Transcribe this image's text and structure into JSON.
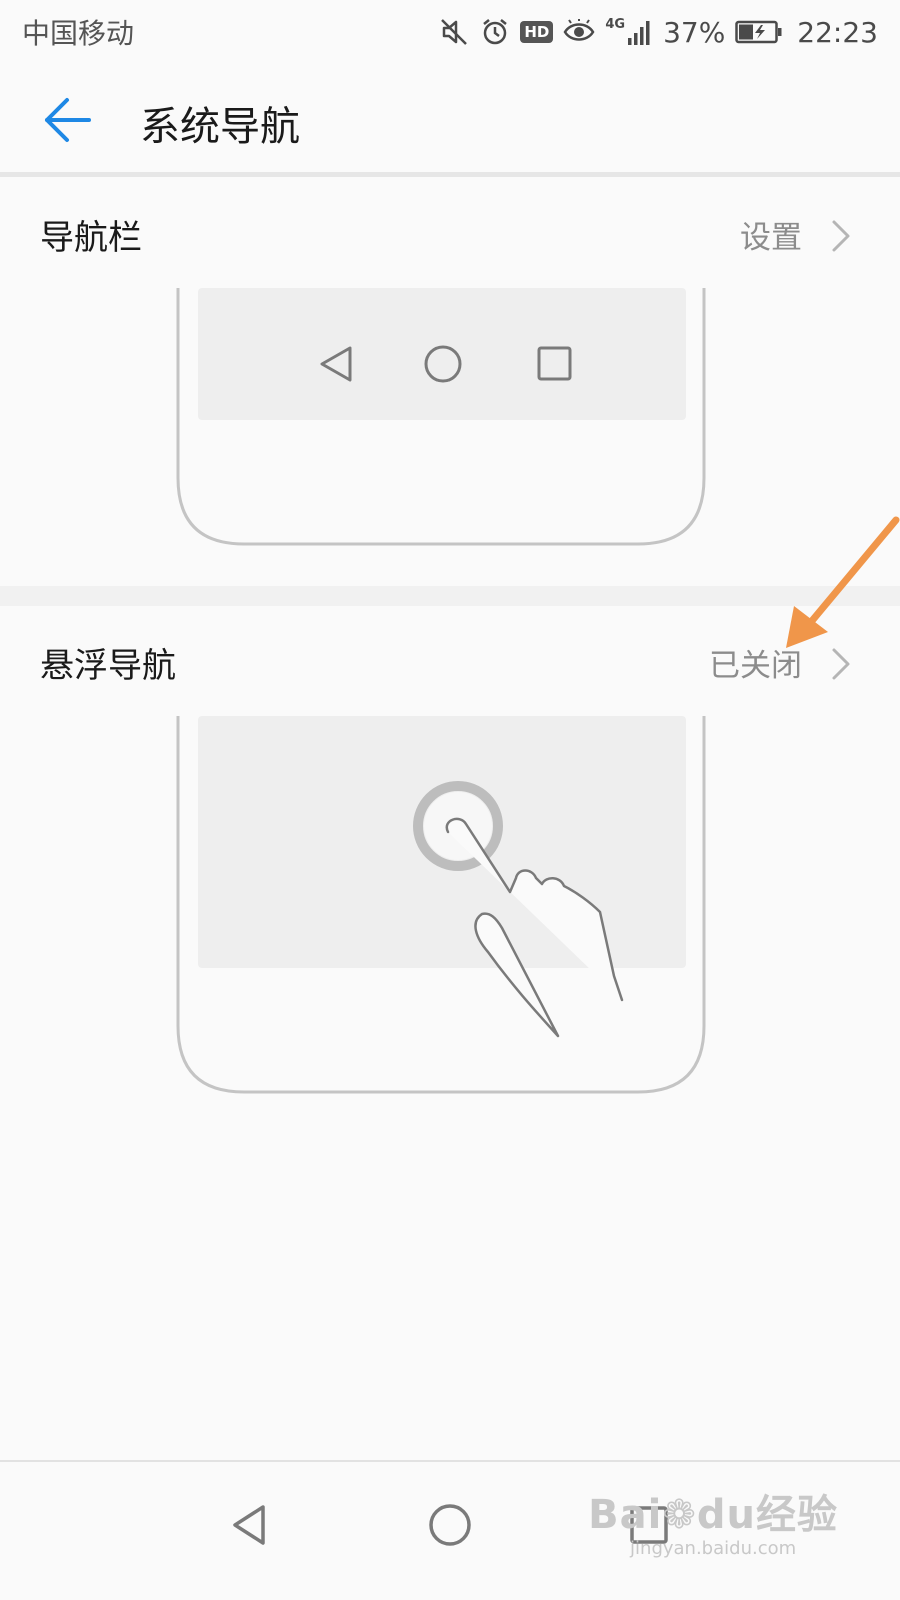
{
  "status_bar": {
    "carrier": "中国移动",
    "network": "4G",
    "battery": "37%",
    "time": "22:23",
    "hd_label": "HD",
    "icons": [
      "mute-icon",
      "alarm-icon",
      "hd-icon",
      "eye-icon",
      "signal-icon",
      "battery-charging-icon"
    ]
  },
  "app_bar": {
    "title": "系统导航",
    "back_icon": "arrow-left-icon"
  },
  "sections": [
    {
      "title": "导航栏",
      "value": "设置",
      "illustration": "three-key-navigation-bar"
    },
    {
      "title": "悬浮导航",
      "value": "已关闭",
      "illustration": "floating-dock-button"
    }
  ],
  "watermark": {
    "logo_text": "Bai",
    "paw_text": "du",
    "cn_text": "经验",
    "url": "jingyan.baidu.com"
  },
  "colors": {
    "accent": "#1e88e5",
    "annotation_arrow": "#f0964a",
    "background": "#fafafa",
    "secondary_text": "#8c8c8c"
  }
}
